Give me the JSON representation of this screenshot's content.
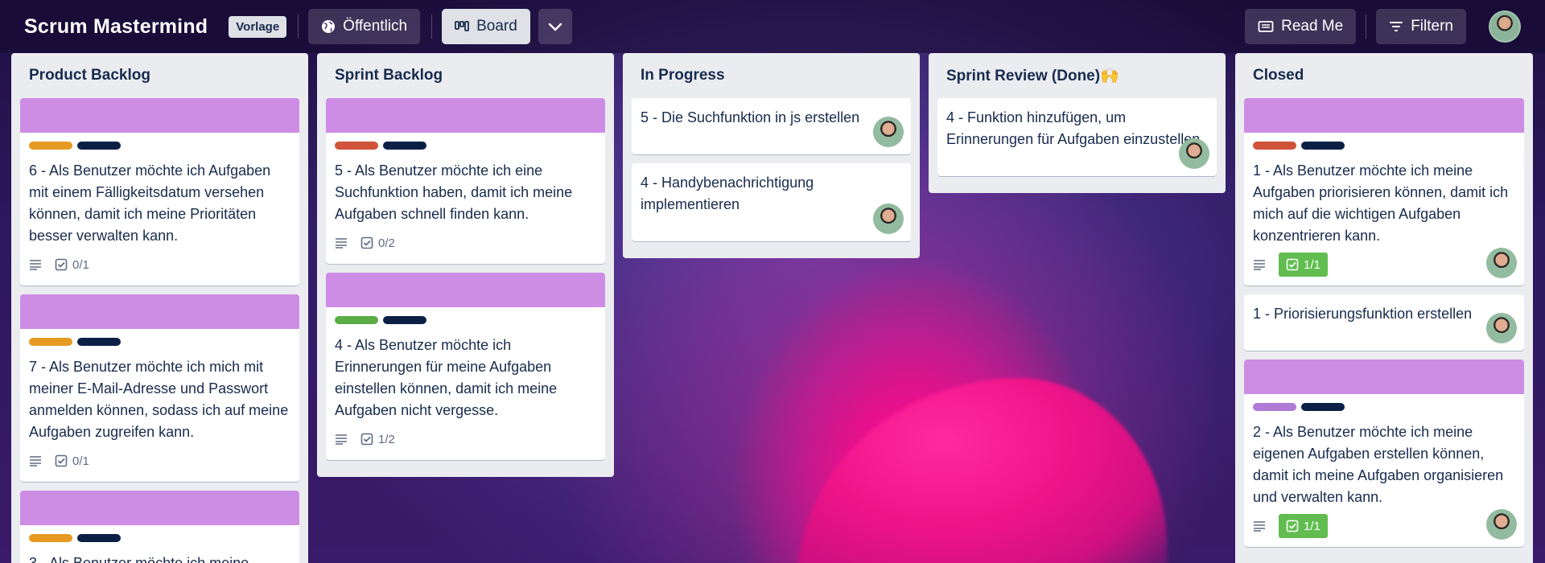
{
  "header": {
    "board_title": "Scrum Mastermind",
    "template_badge": "Vorlage",
    "visibility_label": "Öffentlich",
    "view_label": "Board",
    "readme_label": "Read Me",
    "filter_label": "Filtern"
  },
  "colors": {
    "orange": "#e79a21",
    "navy": "#0c2046",
    "red": "#d0533a",
    "green": "#5aac44",
    "purple": "#b07ad6",
    "cover": "#cd8de5",
    "done_badge": "#61bd4f"
  },
  "lists": [
    {
      "title": "Product Backlog",
      "cards": [
        {
          "text": "6 - Als Benutzer möchte ich Aufgaben mit einem Fälligkeitsdatum versehen können, damit ich meine Prioritäten besser verwalten kann.",
          "checklist": "0/1"
        },
        {
          "text": "7 - Als Benutzer möchte ich mich mit meiner E-Mail-Adresse und Passwort anmelden können, sodass ich auf meine Aufgaben zugreifen kann.",
          "checklist": "0/1"
        },
        {
          "text": "3 - Als Benutzer möchte ich meine"
        }
      ]
    },
    {
      "title": "Sprint Backlog",
      "cards": [
        {
          "text": "5 - Als Benutzer möchte ich eine Suchfunktion haben, damit ich meine Aufgaben schnell finden kann.",
          "checklist": "0/2"
        },
        {
          "text": "4 - Als Benutzer möchte ich Erinnerungen für meine Aufgaben einstellen können, damit ich meine Aufgaben nicht vergesse.",
          "checklist": "1/2"
        }
      ]
    },
    {
      "title": "In Progress",
      "cards": [
        {
          "text": "5 - Die Suchfunktion in js erstellen"
        },
        {
          "text": "4 - Handybenachrichtigung implementieren"
        }
      ]
    },
    {
      "title": "Sprint Review (Done)🙌",
      "cards": [
        {
          "text": "4 - Funktion hinzufügen, um Erinnerungen für Aufgaben einzustellen"
        }
      ]
    },
    {
      "title": "Closed",
      "cards": [
        {
          "text": "1 - Als Benutzer möchte ich meine Aufgaben priorisieren können, damit ich mich auf die wichtigen Aufgaben konzentrieren kann.",
          "checklist": "1/1"
        },
        {
          "text": "1 - Priorisierungsfunktion erstellen"
        },
        {
          "text": "2 - Als Benutzer möchte ich meine eigenen Aufgaben erstellen können, damit ich meine Aufgaben organisieren und verwalten kann.",
          "checklist": "1/1"
        }
      ]
    }
  ]
}
